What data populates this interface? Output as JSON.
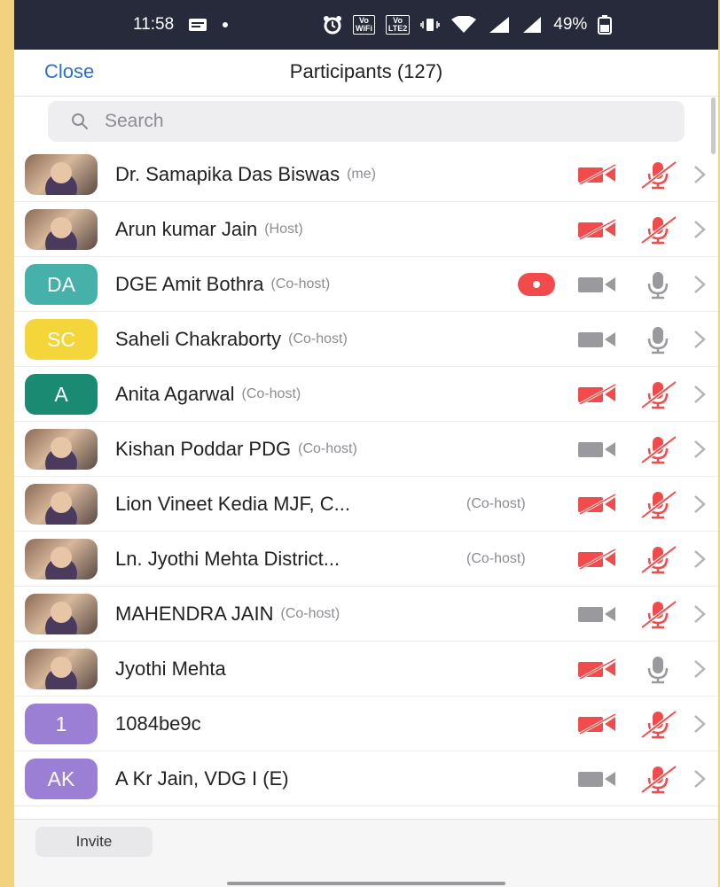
{
  "status_bar": {
    "time": "11:58",
    "battery": "49%",
    "icons": [
      "message-icon",
      "alarm-icon",
      "wifi-calling-icon",
      "volte-icon",
      "vibrate-icon",
      "wifi-icon",
      "signal-icon",
      "battery-icon"
    ],
    "badge_vowifi": "Vo WiFi",
    "badge_lte": "Vo LTE2"
  },
  "header": {
    "close_label": "Close",
    "title": "Participants (127)"
  },
  "search": {
    "placeholder": "Search"
  },
  "colors": {
    "muted_red": "#f34b4b",
    "active_grey": "#9a9a9e",
    "link_blue": "#2d6fd1"
  },
  "participants": [
    {
      "name": "Dr. Samapika Das Biswas",
      "role": "(me)",
      "avatar": "photo",
      "video_off": true,
      "mic_muted": true
    },
    {
      "name": "Arun kumar Jain",
      "role": "(Host)",
      "avatar": "photo",
      "video_off": true,
      "mic_muted": true
    },
    {
      "name": "DGE Amit Bothra",
      "role": "(Co-host)",
      "initials": "DA",
      "avatar_color": "#45b1a8",
      "recording": true,
      "video_off": false,
      "mic_muted": false
    },
    {
      "name": "Saheli Chakraborty",
      "role": "(Co-host)",
      "initials": "SC",
      "avatar_color": "#f4d63a",
      "video_off": false,
      "mic_muted": false
    },
    {
      "name": "Anita Agarwal",
      "role": "(Co-host)",
      "initials": "A",
      "avatar_color": "#1a8a72",
      "video_off": true,
      "mic_muted": true
    },
    {
      "name": "Kishan Poddar PDG",
      "role": "(Co-host)",
      "avatar": "photo",
      "video_off": false,
      "mic_muted": true
    },
    {
      "name": "Lion Vineet Kedia MJF, C...",
      "role": "(Co-host)",
      "avatar": "photo",
      "video_off": true,
      "mic_muted": true
    },
    {
      "name": "Ln. Jyothi Mehta District...",
      "role": "(Co-host)",
      "avatar": "photo",
      "video_off": true,
      "mic_muted": true
    },
    {
      "name": "MAHENDRA JAIN",
      "role": "(Co-host)",
      "avatar": "photo",
      "video_off": false,
      "mic_muted": true
    },
    {
      "name": "Jyothi Mehta",
      "role": "",
      "avatar": "photo",
      "video_off": true,
      "mic_muted": false
    },
    {
      "name": "1084be9c",
      "role": "",
      "initials": "1",
      "avatar_color": "#9b7fd4",
      "video_off": true,
      "mic_muted": true
    },
    {
      "name": "A Kr Jain, VDG I (E)",
      "role": "",
      "initials": "AK",
      "avatar_color": "#9b7fd4",
      "video_off": false,
      "mic_muted": true
    }
  ],
  "footer": {
    "invite_label": "Invite"
  }
}
